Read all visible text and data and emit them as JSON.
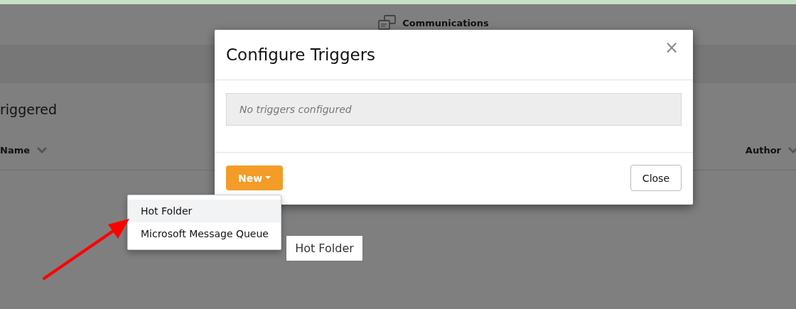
{
  "page": {
    "nav_item": {
      "label": "Communications"
    },
    "heading": "riggered",
    "columns": [
      {
        "label": "Name"
      },
      {
        "label": "Author"
      }
    ]
  },
  "dialog": {
    "title": "Configure Triggers",
    "close": "×",
    "empty_message": "No triggers configured",
    "new_button": {
      "label": "New"
    },
    "close_button": {
      "label": "Close"
    }
  },
  "dropdown": {
    "items": [
      {
        "label": "Hot Folder",
        "selected": true
      },
      {
        "label": "Microsoft Message Queue",
        "selected": false
      }
    ]
  },
  "tooltip": {
    "text": "Hot Folder"
  },
  "annotation": {
    "kind": "arrow"
  }
}
